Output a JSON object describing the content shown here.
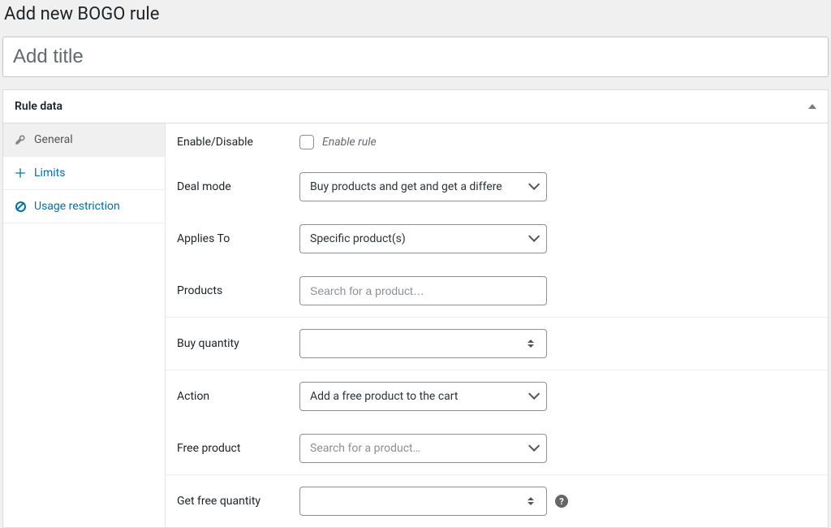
{
  "header": {
    "title": "Add new BOGO rule"
  },
  "titleField": {
    "placeholder": "Add title",
    "value": ""
  },
  "metabox": {
    "title": "Rule data"
  },
  "tabs": [
    {
      "name": "general",
      "label": "General",
      "active": true
    },
    {
      "name": "limits",
      "label": "Limits",
      "active": false
    },
    {
      "name": "usage-restriction",
      "label": "Usage restriction",
      "active": false
    }
  ],
  "fields": {
    "enable": {
      "label": "Enable/Disable",
      "checkbox_label": "Enable rule",
      "checked": false
    },
    "dealMode": {
      "label": "Deal mode",
      "selected": "Buy products and get and get a differe"
    },
    "appliesTo": {
      "label": "Applies To",
      "selected": "Specific product(s)"
    },
    "products": {
      "label": "Products",
      "placeholder": "Search for a product…",
      "value": ""
    },
    "buyQuantity": {
      "label": "Buy quantity",
      "value": ""
    },
    "action": {
      "label": "Action",
      "selected": "Add a free product to the cart"
    },
    "freeProduct": {
      "label": "Free product",
      "placeholder": "Search for a product…",
      "value": ""
    },
    "getFreeQuantity": {
      "label": "Get free quantity",
      "value": ""
    }
  }
}
